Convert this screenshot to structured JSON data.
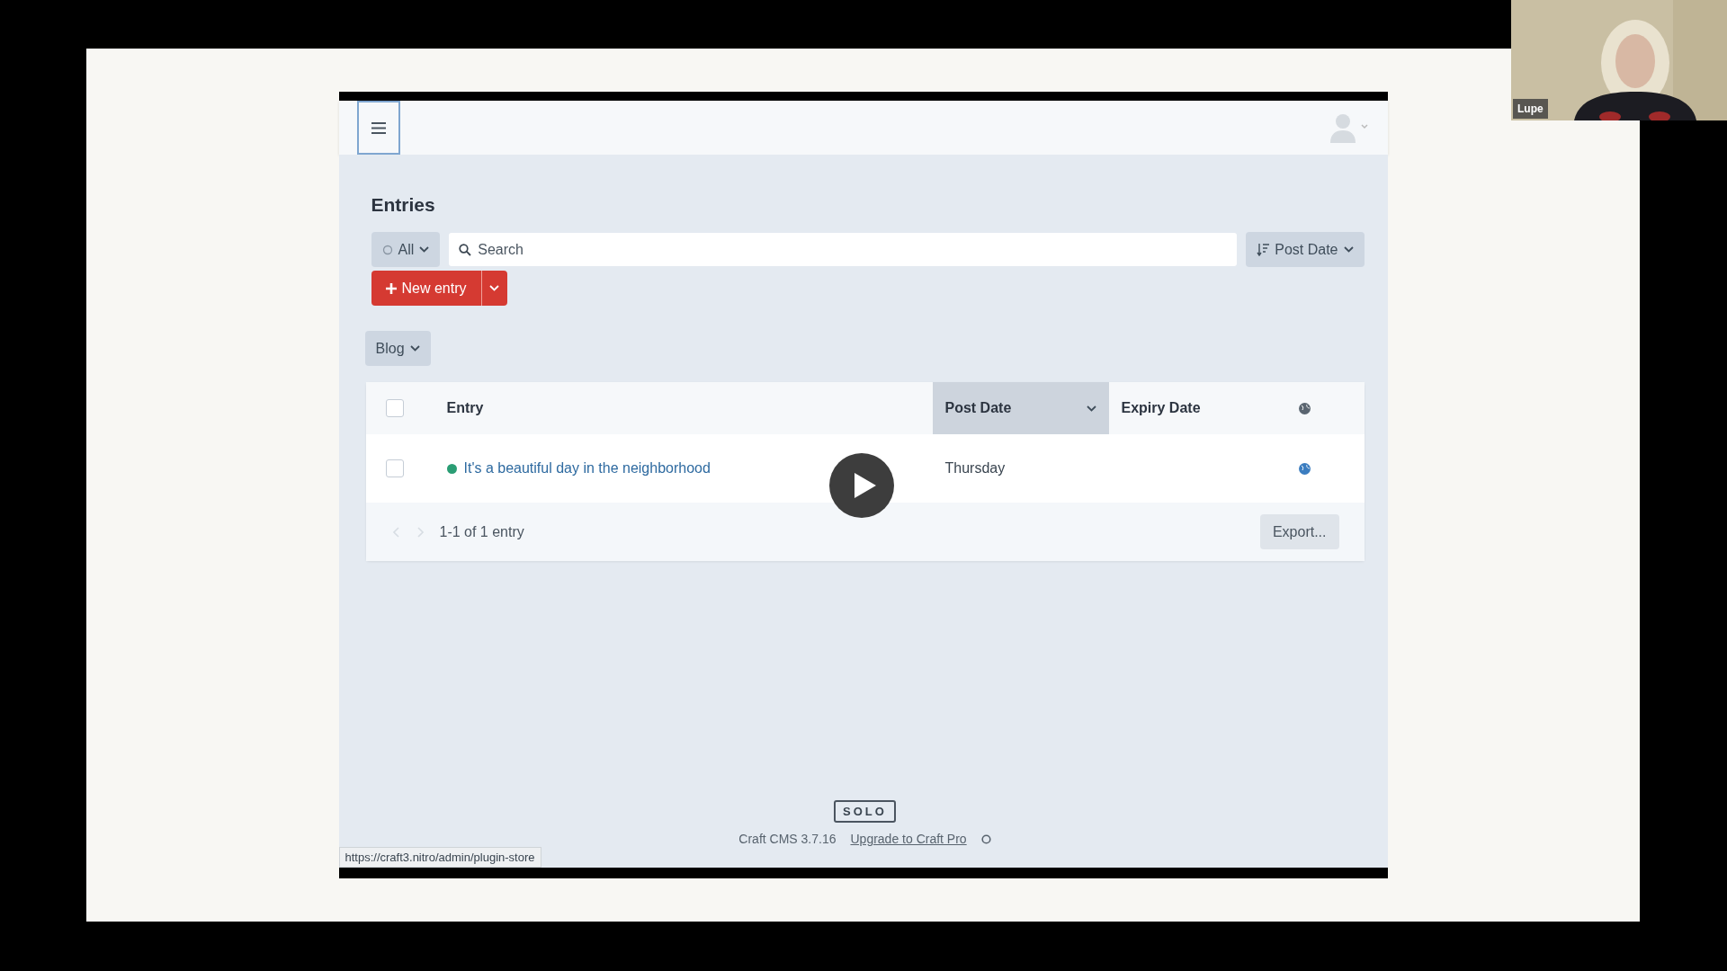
{
  "page_title": "Entries",
  "status_filter": {
    "label": "All"
  },
  "search": {
    "placeholder": "Search"
  },
  "sort": {
    "label": "Post Date"
  },
  "new_entry": {
    "label": "New entry"
  },
  "section": {
    "label": "Blog"
  },
  "table": {
    "select_all_checked": false,
    "columns": [
      {
        "label": "Entry",
        "sorted": false
      },
      {
        "label": "Post Date",
        "sorted": true
      },
      {
        "label": "Expiry Date",
        "sorted": false
      }
    ],
    "rows": [
      {
        "title": "It's a beautiful day in the neighborhood",
        "color": "#2a9d74",
        "post_date": "Thursday",
        "checked": false
      }
    ]
  },
  "pagination": "1-1 of 1 entry",
  "export": "Export...",
  "footer": {
    "edition": "SOLO",
    "version": "Craft CMS 3.7.16",
    "upgrade_link": "Upgrade to Craft Pro"
  },
  "status_url": "https://craft3.nitro/admin/plugin-store",
  "webcam": {
    "name": "Lupe",
    "kind": "picture"
  }
}
